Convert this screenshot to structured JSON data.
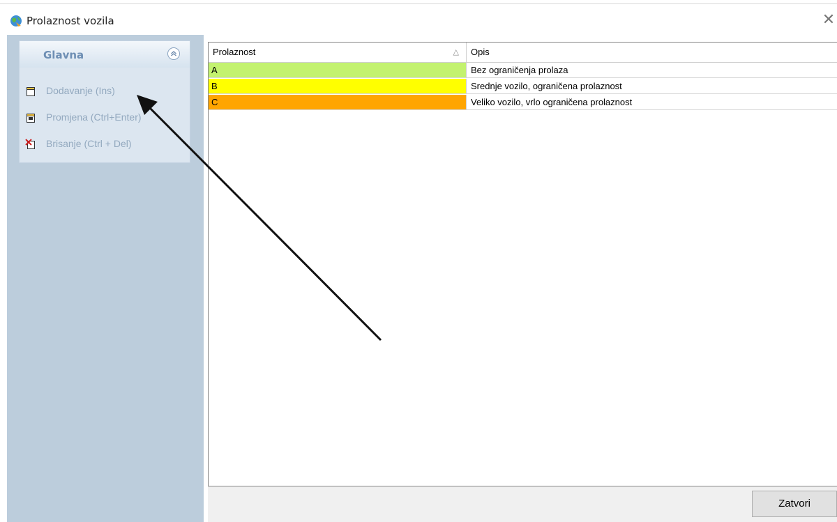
{
  "window": {
    "title": "Prolaznost vozila",
    "app_icon": "globe-app-icon",
    "close_icon": "close-icon",
    "close_glyph": "✕"
  },
  "sidebar": {
    "group_title": "Glavna",
    "collapse_glyph": "⌃",
    "commands": [
      {
        "label": "Dodavanje (Ins)",
        "icon": "new-document-icon"
      },
      {
        "label": "Promjena (Ctrl+Enter)",
        "icon": "edit-document-icon"
      },
      {
        "label": "Brisanje (Ctrl + Del)",
        "icon": "delete-document-icon"
      }
    ]
  },
  "grid": {
    "columns": [
      {
        "label": "Prolaznost",
        "sort_glyph": "△"
      },
      {
        "label": "Opis"
      }
    ],
    "rows": [
      {
        "code": "A",
        "description": "Bez ograničenja prolaza",
        "color": "#c3f26f"
      },
      {
        "code": "B",
        "description": "Srednje vozilo, ograničena prolaznost",
        "color": "#ffff00"
      },
      {
        "code": "C",
        "description": "Veliko vozilo, vrlo ograničena prolaznost",
        "color": "#ffa500"
      }
    ]
  },
  "footer": {
    "close_label": "Zatvori"
  },
  "colors": {
    "sidebar_bg": "#bccddc",
    "disabled_text": "#93a9bf",
    "group_title": "#6e8fb4"
  }
}
